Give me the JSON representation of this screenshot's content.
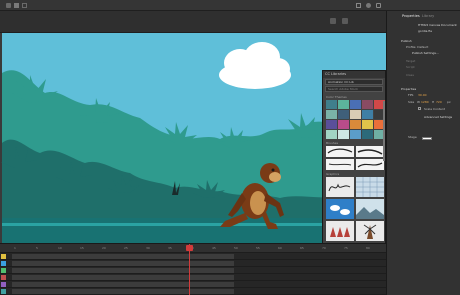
{
  "properties_panel": {
    "tabs": [
      "Properties",
      "Library"
    ],
    "document_type": "HTML5 Canvas Document",
    "file_name": "gorilla.fla",
    "section_publish": "Publish",
    "profile_label": "Profile: Default",
    "publish_settings_label": "Publish Settings...",
    "target_label": "Target",
    "script_label": "Script",
    "class_label": "Class",
    "section_properties": "Properties",
    "fps_label": "FPS",
    "fps_value": "30.00",
    "size_label": "Size",
    "width_value": "1280",
    "width_unit": "W",
    "height_value": "720",
    "height_unit": "H",
    "unit_label": "px",
    "scale_content_label": "Scale Content",
    "advanced_settings_label": "Advanced Settings",
    "stage_label": "Stage",
    "stage_color": "#ffffff"
  },
  "cc_libraries": {
    "title": "CC Libraries",
    "library_name": "Animation CC Lib",
    "search_placeholder": "Search Adobe Stock",
    "section_color_themes": "Color Themes",
    "section_brushes": "Brushes",
    "section_graphics": "Graphics",
    "swatches": [
      "#3f7f8c",
      "#5cb39b",
      "#4a6fb5",
      "#8a4b63",
      "#d24848",
      "#7ab3a7",
      "#3f5f7a",
      "#d9ccb5",
      "#3f7fa5",
      "#3a3a3a",
      "#5a4f9a",
      "#b84c8a",
      "#d98a3a",
      "#e0c34a",
      "#e96f3a",
      "#a2d4c4",
      "#cfe6e3",
      "#5b9dc9",
      "#2c6a7a",
      "#6fb0a4"
    ]
  },
  "timeline": {
    "frame_numbers": [
      "1",
      "5",
      "10",
      "15",
      "20",
      "25",
      "30",
      "35",
      "40",
      "45",
      "50",
      "55",
      "60",
      "65",
      "70",
      "75",
      "80"
    ]
  },
  "colors": {
    "sky": "#5fbfd9",
    "jungle_light": "#2f9b8e",
    "jungle_dark": "#1f6f6a",
    "ground": "#187272",
    "playhead": "#d23b3b",
    "accent": "#4aa3ff"
  }
}
